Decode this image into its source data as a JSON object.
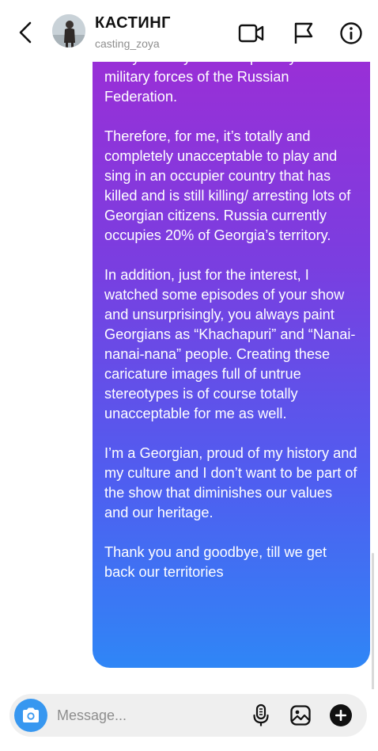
{
  "header": {
    "back_icon": "chevron-left-icon",
    "title": "КАСТИНГ",
    "username": "casting_zoya",
    "icons": [
      "video-call-icon",
      "flag-icon",
      "info-icon"
    ]
  },
  "message": {
    "paragraphs": [
      "of my country are occupied by the military forces of the Russian Federation.",
      "Therefore, for me, it’s totally and completely unacceptable to play and sing in an occupier country that has killed and is still killing/ arresting lots of Georgian citizens. Russia currently occupies 20% of Georgia’s territory.",
      "In addition, just for the interest, I watched some episodes of your show and unsurprisingly, you always paint Georgians as “Khachapuri” and “Nanai-nanai-nana” people. Creating these caricature images full of untrue stereotypes is of course totally unacceptable for me as well.",
      "I’m a Georgian, proud of my history and my culture and I don’t want to be part of the show that diminishes our values and our heritage.",
      "Thank you and goodbye, till we get back our territories"
    ],
    "gradient_colors": [
      "#9b2ed6",
      "#7a3ee0",
      "#4f5ef0",
      "#2f86f6"
    ]
  },
  "composer": {
    "placeholder": "Message...",
    "value": "",
    "camera_color": "#3797f0",
    "icons": [
      "camera-icon",
      "microphone-icon",
      "gallery-icon",
      "add-icon"
    ]
  }
}
